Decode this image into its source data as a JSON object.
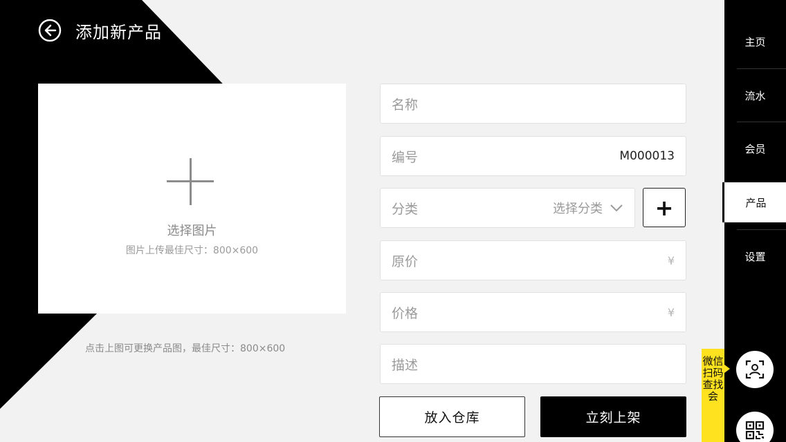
{
  "header": {
    "title": "添加新产品",
    "back_icon": "back-arrow-icon"
  },
  "upload": {
    "label": "选择图片",
    "hint": "图片上传最佳尺寸：800×600",
    "caption": "点击上图可更换产品图，最佳尺寸：800×600"
  },
  "form": {
    "name": {
      "label": "名称",
      "value": ""
    },
    "code": {
      "label": "编号",
      "value": "M000013"
    },
    "category": {
      "label": "分类",
      "placeholder": "选择分类",
      "add_label": "+"
    },
    "original_price": {
      "label": "原价",
      "unit": "¥"
    },
    "price": {
      "label": "价格",
      "unit": "¥"
    },
    "description": {
      "label": "描述",
      "value": ""
    }
  },
  "actions": {
    "store_label": "放入仓库",
    "shelf_label": "立刻上架"
  },
  "sidebar": {
    "items": [
      {
        "label": "主页",
        "active": false
      },
      {
        "label": "流水",
        "active": false
      },
      {
        "label": "会员",
        "active": false
      },
      {
        "label": "产品",
        "active": true
      },
      {
        "label": "设置",
        "active": false
      }
    ],
    "wechat_tab": "微信扫码查找会",
    "scan_icon": "face-scan-icon",
    "qr_icon": "qr-code-icon"
  },
  "colors": {
    "background": "#f2f2f2",
    "sidebar": "#000000",
    "accent_yellow": "#ffe21f",
    "primary_button": "#000000"
  }
}
